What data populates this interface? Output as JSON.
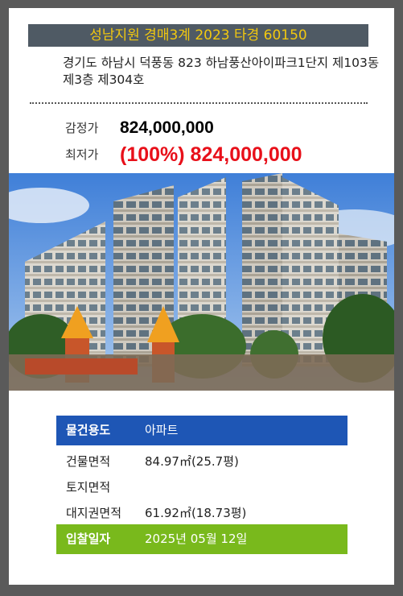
{
  "header": {
    "title": "성남지원 경매3계 2023 타경 60150"
  },
  "property": {
    "address": "경기도 하남시 덕풍동 823 하남풍산아이파크1단지 제103동 제3층 제304호"
  },
  "prices": {
    "appraisal_label": "감정가",
    "appraisal_value": "824,000,000",
    "minimum_label": "최저가",
    "minimum_value": "(100%) 824,000,000"
  },
  "details": {
    "usage_label": "물건용도",
    "usage_value": "아파트",
    "building_area_label": "건물면적",
    "building_area_value": "84.97㎡(25.7평)",
    "land_area_label": "토지면적",
    "land_area_value": "",
    "land_right_label": "대지권면적",
    "land_right_value": "61.92㎡(18.73평)",
    "bid_date_label": "입찰일자",
    "bid_date_value": "2025년 05월 12일"
  },
  "colors": {
    "header_bg": "#4f5a64",
    "header_text": "#f2c80f",
    "minimum_price": "#e8101a",
    "usage_row": "#1e56b5",
    "bid_row": "#79b91c"
  }
}
